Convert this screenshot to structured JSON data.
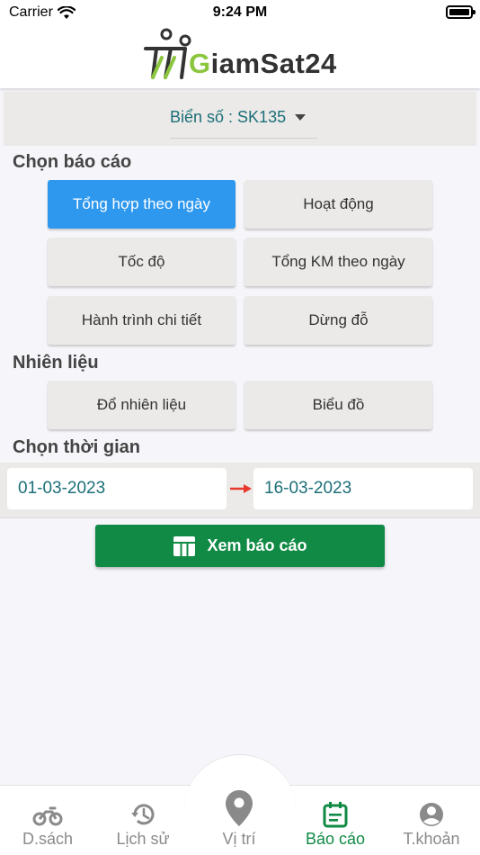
{
  "status": {
    "carrier": "Carrier",
    "time": "9:24 PM"
  },
  "brand": {
    "logo_prefix": "G",
    "logo_rest": "iamSat24",
    "accent": "#8cc63f"
  },
  "plate": {
    "label": "Biển số : SK135"
  },
  "sections": {
    "reports": "Chọn báo cáo",
    "fuel": "Nhiên liệu",
    "time": "Chọn thời gian"
  },
  "report_buttons": [
    {
      "label": "Tổng hợp theo ngày",
      "active": true
    },
    {
      "label": "Hoạt động"
    },
    {
      "label": "Tốc độ"
    },
    {
      "label": "Tổng KM theo ngày"
    },
    {
      "label": "Hành trình chi tiết"
    },
    {
      "label": "Dừng đỗ"
    }
  ],
  "fuel_buttons": [
    {
      "label": "Đổ nhiên liệu"
    },
    {
      "label": "Biểu đồ"
    }
  ],
  "dates": {
    "from": "01-03-2023",
    "to": "16-03-2023"
  },
  "view_report": {
    "label": "Xem báo cáo",
    "color": "#108a45"
  },
  "tabs": [
    {
      "label": "D.sách",
      "icon": "motorbike-icon"
    },
    {
      "label": "Lịch sử",
      "icon": "history-icon"
    },
    {
      "label": "Vị trí",
      "icon": "location-pin-icon"
    },
    {
      "label": "Báo cáo",
      "icon": "report-icon",
      "active": true
    },
    {
      "label": "T.khoản",
      "icon": "account-icon"
    }
  ],
  "colors": {
    "primary_blue": "#2e98ef",
    "teal_text": "#1c6f78",
    "green": "#108a45"
  }
}
